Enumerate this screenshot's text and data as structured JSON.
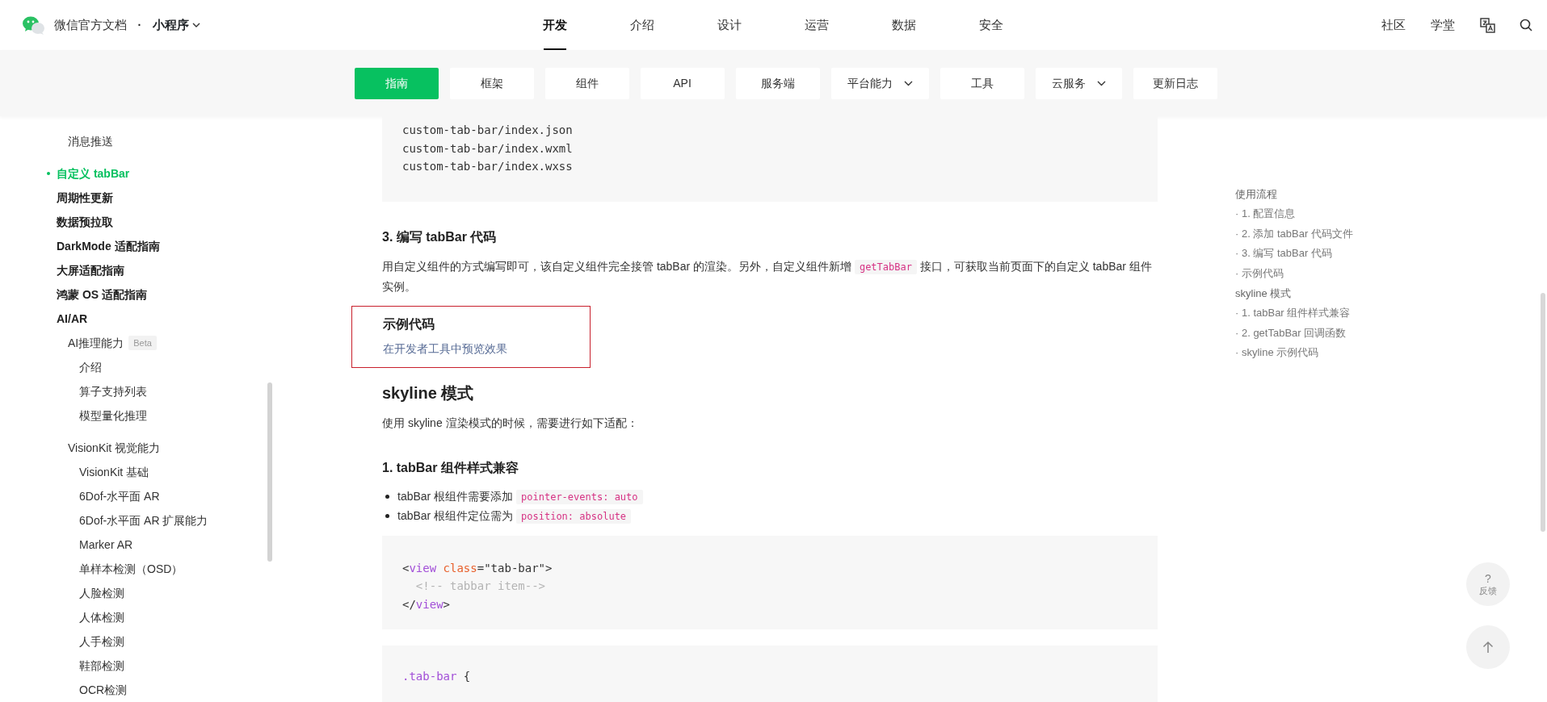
{
  "header": {
    "site_title": "微信官方文档",
    "separator": "·",
    "product": "小程序",
    "tabs": [
      {
        "label": "开发",
        "selected": true
      },
      {
        "label": "介绍",
        "selected": false
      },
      {
        "label": "设计",
        "selected": false
      },
      {
        "label": "运营",
        "selected": false
      },
      {
        "label": "数据",
        "selected": false
      },
      {
        "label": "安全",
        "selected": false
      }
    ],
    "links": [
      "社区",
      "学堂"
    ]
  },
  "subnav": [
    {
      "label": "指南",
      "selected": true,
      "dropdown": false
    },
    {
      "label": "框架",
      "selected": false,
      "dropdown": false
    },
    {
      "label": "组件",
      "selected": false,
      "dropdown": false
    },
    {
      "label": "API",
      "selected": false,
      "dropdown": false
    },
    {
      "label": "服务端",
      "selected": false,
      "dropdown": false
    },
    {
      "label": "平台能力",
      "selected": false,
      "dropdown": true
    },
    {
      "label": "工具",
      "selected": false,
      "dropdown": false
    },
    {
      "label": "云服务",
      "selected": false,
      "dropdown": true
    },
    {
      "label": "更新日志",
      "selected": false,
      "dropdown": false
    }
  ],
  "sidebar": {
    "items": [
      {
        "label": "消息推送",
        "kind": "sub",
        "selected": false
      },
      {
        "label": "自定义 tabBar",
        "kind": "top",
        "selected": true
      },
      {
        "label": "周期性更新",
        "kind": "top",
        "selected": false
      },
      {
        "label": "数据预拉取",
        "kind": "top",
        "selected": false
      },
      {
        "label": "DarkMode 适配指南",
        "kind": "top",
        "selected": false
      },
      {
        "label": "大屏适配指南",
        "kind": "top",
        "selected": false
      },
      {
        "label": "鸿蒙 OS 适配指南",
        "kind": "top",
        "selected": false
      },
      {
        "label": "AI/AR",
        "kind": "top",
        "selected": false,
        "children": [
          {
            "label": "AI推理能力",
            "badge": "Beta",
            "selected": false,
            "children": [
              {
                "label": "介绍",
                "selected": false
              },
              {
                "label": "算子支持列表",
                "selected": false
              },
              {
                "label": "模型量化推理",
                "selected": false
              }
            ]
          },
          {
            "label": "VisionKit 视觉能力",
            "selected": false,
            "children": [
              {
                "label": "VisionKit 基础",
                "selected": false
              },
              {
                "label": "6Dof-水平面 AR",
                "selected": false
              },
              {
                "label": "6Dof-水平面 AR 扩展能力",
                "selected": false
              },
              {
                "label": "Marker AR",
                "selected": false
              },
              {
                "label": "单样本检测（OSD）",
                "selected": false
              },
              {
                "label": "人脸检测",
                "selected": false
              },
              {
                "label": "人体检测",
                "selected": false
              },
              {
                "label": "人手检测",
                "selected": false
              },
              {
                "label": "鞋部检测",
                "selected": false
              },
              {
                "label": "OCR检测",
                "selected": false
              }
            ]
          }
        ]
      }
    ]
  },
  "content": [
    {
      "kind": "code",
      "lines": [
        [
          {
            "t": "custom-tab-bar/index.json"
          }
        ],
        [
          {
            "t": "custom-tab-bar/index.wxml"
          }
        ],
        [
          {
            "t": "custom-tab-bar/index.wxss"
          }
        ]
      ]
    },
    {
      "kind": "h3",
      "text": "3. 编写 tabBar 代码"
    },
    {
      "kind": "paragraph",
      "parts": [
        {
          "text": "用自定义组件的方式编写即可，该自定义组件完全接管 tabBar 的渲染。另外，自定义组件新增 "
        },
        {
          "code": "getTabBar"
        },
        {
          "text": " 接口，可获取当前页面下的自定义 tabBar 组件实例。"
        }
      ]
    },
    {
      "kind": "example",
      "title": "示例代码",
      "link": "在开发者工具中预览效果"
    },
    {
      "kind": "h2",
      "text": "skyline 模式"
    },
    {
      "kind": "paragraph",
      "parts": [
        {
          "text": "使用 skyline 渲染模式的时候，需要进行如下适配："
        }
      ]
    },
    {
      "kind": "h3",
      "text": "1. tabBar 组件样式兼容"
    },
    {
      "kind": "bullets",
      "items": [
        {
          "parts": [
            {
              "text": "tabBar 根组件需要添加 "
            },
            {
              "code": "pointer-events: auto"
            }
          ]
        },
        {
          "parts": [
            {
              "text": "tabBar 根组件定位需为 "
            },
            {
              "code": "position: absolute"
            }
          ]
        }
      ]
    },
    {
      "kind": "code",
      "lines": [
        [
          {
            "t": "<"
          },
          {
            "t": "view",
            "color": "#a24fd8"
          },
          {
            "t": " class",
            "color": "#e8602c"
          },
          {
            "t": "=\"tab-bar\">"
          }
        ],
        [
          {
            "t": "  <!-- tabbar item-->",
            "color": "#b4b4b4"
          }
        ],
        [
          {
            "t": "</"
          },
          {
            "t": "view",
            "color": "#a24fd8"
          },
          {
            "t": ">"
          }
        ]
      ]
    },
    {
      "kind": "code",
      "lines": [
        [
          {
            "t": ".tab-bar",
            "color": "#a24fd8"
          },
          {
            "t": " {"
          }
        ]
      ]
    }
  ],
  "toc": [
    {
      "label": "使用流程",
      "children": [
        "· 1. 配置信息",
        "· 2. 添加 tabBar 代码文件",
        "· 3. 编写 tabBar 代码",
        "· 示例代码"
      ]
    },
    {
      "label": "skyline 模式",
      "children": [
        "· 1. tabBar 组件样式兼容",
        "· 2. getTabBar 回调函数",
        "· skyline 示例代码"
      ]
    }
  ],
  "feedback": {
    "symbol": "?",
    "label": "反馈"
  }
}
